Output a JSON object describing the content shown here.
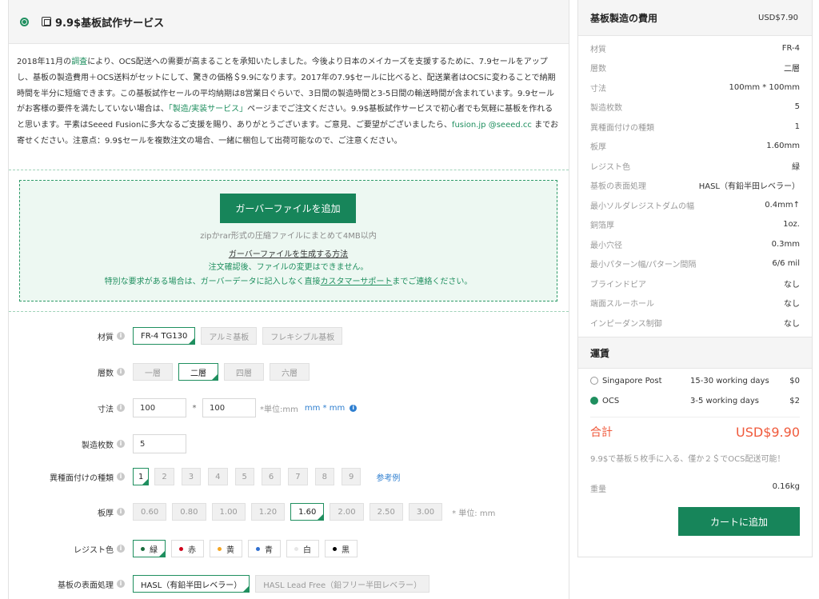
{
  "left": {
    "title": "9.9$基板試作サービス",
    "intro": {
      "p1": "2018年11月の",
      "p1_link": "調査",
      "p2": "により、OCS配送への需要が高まることを承知いたしました。今後より日本のメイカーズを支援するために、7.9セールをアップし、基板の製造費用＋OCS送料がセットにして、驚きの価格＄9.9になります。2017年の7.9$セールに比べると、配送業者はOCSに変わることで納期時間を半分に短縮できます。この基板試作セールの平均納期は8営業日ぐらいで、3日間の製造時間と3-5日間の輸送時間が含まれています。9.9セールがお客様の要件を満たしていない場合は、",
      "p2_link": "「製造/実装サービス」",
      "p3": "ページまでご注文ください。9.9$基板試作サービスで初心者でも気軽に基板を作れると思います。平素はSeeed Fusionに多大なるご支援を賜り、ありがとうございます。ご意見、ご要望がございましたら、",
      "p3_link": "fusion.jp @seeed.cc",
      "p4": " までお寄せください。注意点：9.9$セールを複数注文の場合、一緒に梱包して出荷可能なので、ご注意ください。"
    },
    "upload": {
      "button": "ガーバーファイルを追加",
      "hint": "zipかrar形式の圧縮ファイルにまとめて4MB以内",
      "howto": "ガーバーファイルを生成する方法",
      "note1": "注文確認後、ファイルの変更はできません。",
      "note2_a": "特別な要求がある場合は、ガーバーデータに記入しなく直接",
      "note2_link": "カスタマーサポート",
      "note2_b": "までご連絡ください。"
    },
    "form": {
      "material": {
        "label": "材質",
        "options": [
          "FR-4 TG130",
          "アルミ基板",
          "フレキシブル基板"
        ]
      },
      "layers": {
        "label": "層数",
        "options": [
          "一層",
          "二層",
          "四層",
          "六層"
        ]
      },
      "size": {
        "label": "寸法",
        "width": "100",
        "sep": "*",
        "height": "100",
        "unit": "*単位:mm",
        "unit_alt": "mm * mm"
      },
      "quantity": {
        "label": "製造枚数",
        "value": "5"
      },
      "designs": {
        "label": "異種面付けの種類",
        "options": [
          "1",
          "2",
          "3",
          "4",
          "5",
          "6",
          "7",
          "8",
          "9"
        ],
        "ref": "参考例"
      },
      "thickness": {
        "label": "板厚",
        "options": [
          "0.60",
          "0.80",
          "1.00",
          "1.20",
          "1.60",
          "2.00",
          "2.50",
          "3.00"
        ],
        "unit": "* 単位: mm"
      },
      "mask": {
        "label": "レジスト色",
        "options": [
          "緑",
          "赤",
          "黄",
          "青",
          "白",
          "黒"
        ]
      },
      "finish": {
        "label": "基板の表面処理",
        "options": [
          "HASL（有鉛半田レベラー）",
          "HASL Lead Free（鉛フリー半田レベラー）"
        ]
      }
    }
  },
  "right": {
    "title": "基板製造の費用",
    "price": "USD$7.90",
    "specs": [
      {
        "k": "材質",
        "v": "FR-4"
      },
      {
        "k": "層数",
        "v": "二層"
      },
      {
        "k": "寸法",
        "v": "100mm * 100mm"
      },
      {
        "k": "製造枚数",
        "v": "5"
      },
      {
        "k": "異種面付けの種類",
        "v": "1"
      },
      {
        "k": "板厚",
        "v": "1.60mm"
      },
      {
        "k": "レジスト色",
        "v": "緑"
      },
      {
        "k": "基板の表面処理",
        "v": "HASL（有鉛半田レベラー）"
      },
      {
        "k": "最小ソルダレジストダムの幅",
        "v": "0.4mm↑"
      },
      {
        "k": "銅箔厚",
        "v": "1oz."
      },
      {
        "k": "最小穴径",
        "v": "0.3mm"
      },
      {
        "k": "最小パターン幅/パターン間隔",
        "v": "6/6 mil"
      },
      {
        "k": "ブラインドビア",
        "v": "なし"
      },
      {
        "k": "端面スルーホール",
        "v": "なし"
      },
      {
        "k": "インピーダンス制御",
        "v": "なし"
      }
    ],
    "shipping_title": "運賃",
    "shipping": [
      {
        "name": "Singapore Post",
        "days": "15-30 working days",
        "price": "$0",
        "selected": false
      },
      {
        "name": "OCS",
        "days": "3-5 working days",
        "price": "$2",
        "selected": true
      }
    ],
    "total_label": "合計",
    "total_value": "USD$9.90",
    "promo": "9.9$で基板５枚手に入る、僅か２＄でOCS配送可能！",
    "weight_label": "重量",
    "weight_value": "0.16kg",
    "cart_button": "カートに追加"
  },
  "colors": {
    "accent": "#17855a",
    "total": "#f05a3c",
    "link": "#2f7fd0"
  }
}
